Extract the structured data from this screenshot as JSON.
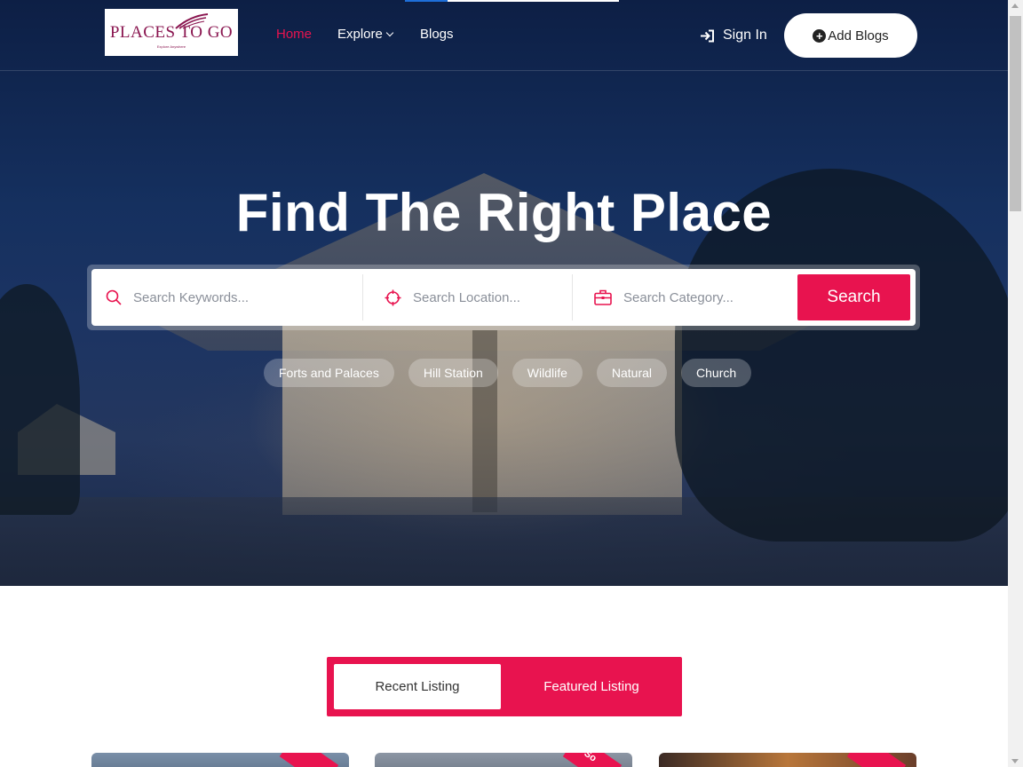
{
  "logo": {
    "name": "PLACES TO GO",
    "tagline": "Explore Anywhere"
  },
  "nav": [
    {
      "label": "Home",
      "active": true
    },
    {
      "label": "Explore",
      "has_dropdown": true
    },
    {
      "label": "Blogs"
    }
  ],
  "header": {
    "signin_label": "Sign In",
    "add_blogs_label": "Add Blogs",
    "add_blogs_icon": "+"
  },
  "hero": {
    "title": "Find The Right Place"
  },
  "search": {
    "keywords_placeholder": "Search Keywords...",
    "location_placeholder": "Search Location...",
    "category_placeholder": "Search Category...",
    "button_label": "Search"
  },
  "tags": [
    "Forts and Palaces",
    "Hill Station",
    "Wildlife",
    "Natural",
    "Church"
  ],
  "listing_tabs": {
    "recent": "Recent Listing",
    "featured": "Featured Listing"
  },
  "cards": [
    {
      "ribbon": ""
    },
    {
      "ribbon": "So"
    },
    {
      "ribbon": ""
    }
  ],
  "colors": {
    "accent": "#e8134f",
    "hero_bg": "#15305f",
    "logo": "#8a1650"
  },
  "icons": {
    "signin": "sign-in-icon",
    "keywords": "search-icon",
    "location": "crosshair-icon",
    "category": "briefcase-icon"
  }
}
